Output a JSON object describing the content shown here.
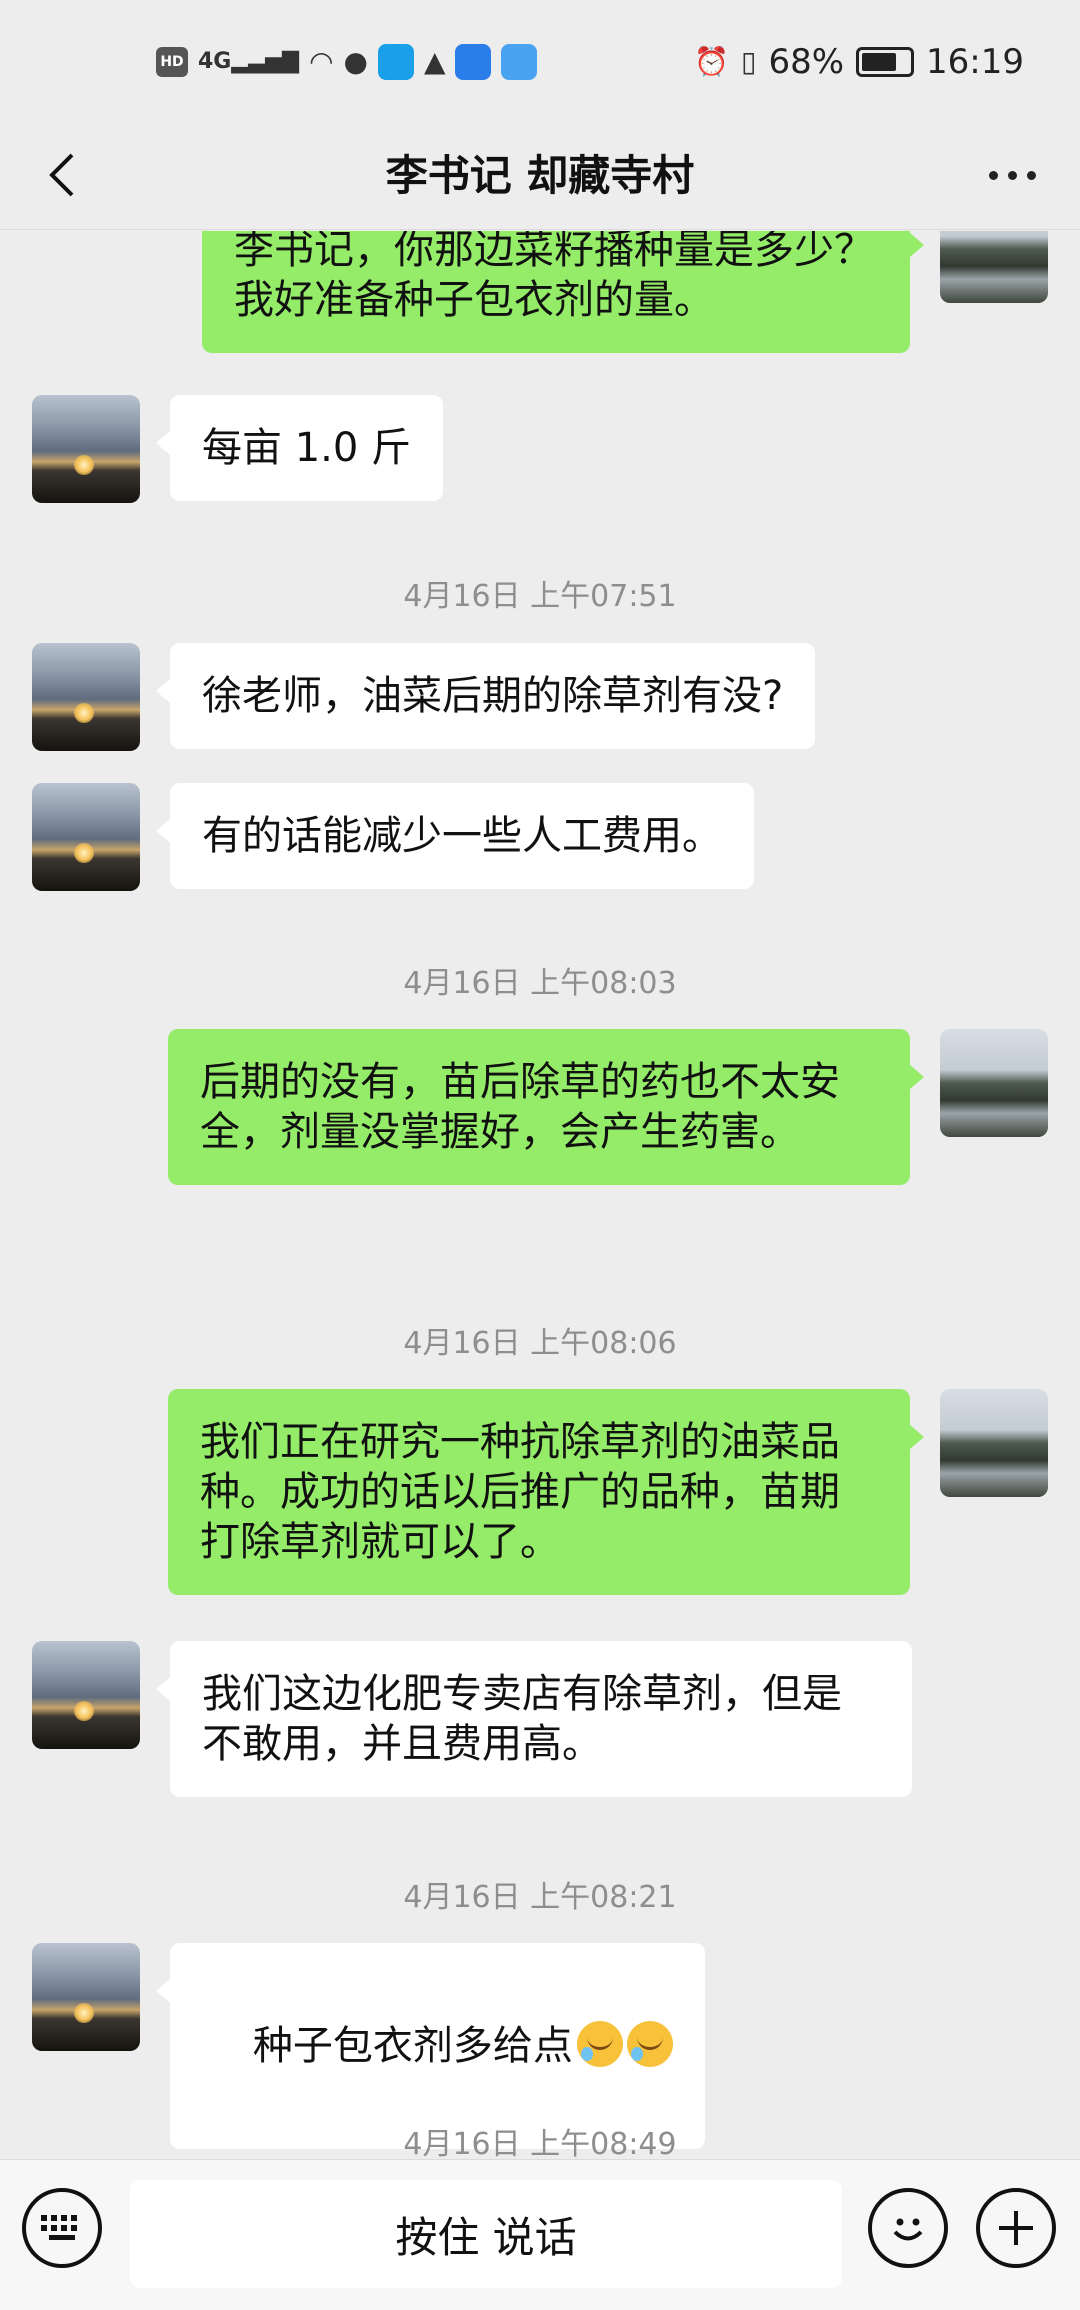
{
  "status_bar": {
    "hd_label": "HD",
    "network": "4G",
    "battery": "68%",
    "time": "16:19"
  },
  "header": {
    "title": "李书记 却藏寺村"
  },
  "messages": [
    {
      "type": "out",
      "text": "李书记，你那边菜籽播种量是多少？我好准备种子包衣剂的量。"
    },
    {
      "type": "in",
      "text": "每亩 1.0 斤"
    },
    {
      "type": "time",
      "text": "4月16日 上午07:51"
    },
    {
      "type": "in",
      "text": "徐老师，油菜后期的除草剂有没?"
    },
    {
      "type": "in",
      "text": "有的话能减少一些人工费用。"
    },
    {
      "type": "time",
      "text": "4月16日 上午08:03"
    },
    {
      "type": "out",
      "text": "后期的没有，苗后除草的药也不太安全，剂量没掌握好，会产生药害。"
    },
    {
      "type": "time",
      "text": "4月16日 上午08:06"
    },
    {
      "type": "out",
      "text": "我们正在研究一种抗除草剂的油菜品种。成功的话以后推广的品种，苗期打除草剂就可以了。"
    },
    {
      "type": "in",
      "text": "我们这边化肥专卖店有除草剂，但是不敢用，并且费用高。"
    },
    {
      "type": "time",
      "text": "4月16日 上午08:21"
    },
    {
      "type": "in",
      "text": "种子包衣剂多给点"
    },
    {
      "type": "time",
      "text": "4月16日 上午08:49"
    }
  ],
  "input_bar": {
    "hold_to_talk": "按住 说话"
  },
  "colors": {
    "outgoing_bubble": "#95ec69",
    "incoming_bubble": "#ffffff",
    "background": "#ededed"
  }
}
